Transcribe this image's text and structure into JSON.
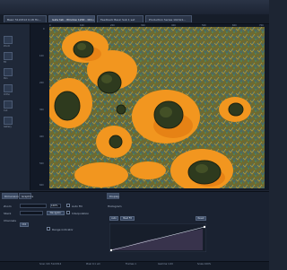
{
  "tabs": [
    "Basic 512x512 0.18 Hx...",
    "Gate tab - Window 1200 - 001.czi",
    "Feedback Basic Sub 1 set",
    "Production Series 1024x1..."
  ],
  "left_panel": {
    "labels": [
      "Zoom",
      "Fit",
      "Pan",
      "Ortho",
      "Cut",
      "Gallery"
    ]
  },
  "viewer": {
    "x_ticks": [
      "0",
      "100",
      "200",
      "300",
      "400",
      "500",
      "600",
      "700"
    ],
    "y_ticks": [
      "0",
      "100",
      "200",
      "300",
      "400",
      "500",
      "600"
    ]
  },
  "bottom_panel": {
    "tabs": [
      "Dimensions",
      "Graphics"
    ],
    "right_tab": "Display",
    "rows": [
      {
        "label": "Zoom"
      },
      {
        "label": "Stack"
      },
      {
        "label": "Channels"
      }
    ],
    "zoom_value": "100%",
    "checkbox_labels": [
      "Auto Fill",
      "Interpolation"
    ],
    "navigator_label": "Navigator",
    "range_label": "Range indicator",
    "ch_label": "Ch1",
    "histogram_header": "Histogram",
    "hist_tab_labels": [
      "Auto",
      "Best Fit",
      "Reset"
    ]
  },
  "status": [
    "Scan Info 512x512",
    "Pixel 0.1 um",
    "Frames 1",
    "Gamma 1.00",
    "Scale 100%"
  ],
  "colors": {
    "accent": "#e8921d"
  }
}
